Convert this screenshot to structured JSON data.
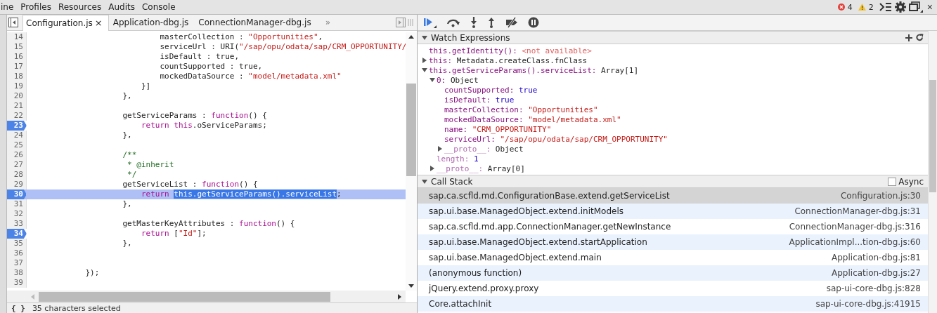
{
  "panel_tabs": [
    {
      "label": "ine",
      "selected": false
    },
    {
      "label": "Profiles",
      "selected": false
    },
    {
      "label": "Resources",
      "selected": false
    },
    {
      "label": "Audits",
      "selected": false
    },
    {
      "label": "Console",
      "selected": false
    }
  ],
  "counters": {
    "errors": "4",
    "warnings": "2"
  },
  "close": "×",
  "editor": {
    "tabs": [
      {
        "label": "Configuration.js",
        "selected": true,
        "close": "×"
      },
      {
        "label": "Application-dbg.js",
        "selected": false
      },
      {
        "label": "ConnectionManager-dbg.js",
        "selected": false
      }
    ],
    "more": "»",
    "lines": [
      {
        "number": "14",
        "breakpoint": false,
        "current": false,
        "tokens": [
          {
            "kind": "plain",
            "text": "                            masterCollection : "
          },
          {
            "kind": "string",
            "text": "\"Opportunities\""
          },
          {
            "kind": "plain",
            "text": ","
          }
        ]
      },
      {
        "number": "15",
        "breakpoint": false,
        "current": false,
        "tokens": [
          {
            "kind": "plain",
            "text": "                            serviceUrl : URI("
          },
          {
            "kind": "string",
            "text": "\"/sap/opu/odata/sap/CRM_OPPORTUNITY/"
          }
        ]
      },
      {
        "number": "16",
        "breakpoint": false,
        "current": false,
        "tokens": [
          {
            "kind": "plain",
            "text": "                            isDefault : true,"
          }
        ]
      },
      {
        "number": "17",
        "breakpoint": false,
        "current": false,
        "tokens": [
          {
            "kind": "plain",
            "text": "                            countSupported : true,"
          }
        ]
      },
      {
        "number": "18",
        "breakpoint": false,
        "current": false,
        "tokens": [
          {
            "kind": "plain",
            "text": "                            mockedDataSource : "
          },
          {
            "kind": "string",
            "text": "\"model/metadata.xml\""
          }
        ]
      },
      {
        "number": "19",
        "breakpoint": false,
        "current": false,
        "tokens": [
          {
            "kind": "plain",
            "text": "                        }]"
          }
        ]
      },
      {
        "number": "20",
        "breakpoint": false,
        "current": false,
        "tokens": [
          {
            "kind": "plain",
            "text": "                    },"
          }
        ]
      },
      {
        "number": "21",
        "breakpoint": false,
        "current": false
      },
      {
        "number": "22",
        "breakpoint": false,
        "current": false,
        "tokens": [
          {
            "kind": "plain",
            "text": "                    getServiceParams : "
          },
          {
            "kind": "keyword",
            "text": "function"
          },
          {
            "kind": "plain",
            "text": "() {"
          }
        ]
      },
      {
        "number": "23",
        "breakpoint": true,
        "current": false,
        "tokens": [
          {
            "kind": "keyword",
            "text": "                        return this"
          },
          {
            "kind": "plain",
            "text": ".oServiceParams;"
          }
        ]
      },
      {
        "number": "24",
        "breakpoint": false,
        "current": false,
        "tokens": [
          {
            "kind": "plain",
            "text": "                    },"
          }
        ]
      },
      {
        "number": "25",
        "breakpoint": false,
        "current": false
      },
      {
        "number": "26",
        "breakpoint": false,
        "current": false,
        "tokens": [
          {
            "kind": "comment",
            "text": "                    /**"
          }
        ]
      },
      {
        "number": "27",
        "breakpoint": false,
        "current": false,
        "tokens": [
          {
            "kind": "comment",
            "text": "                     * @inherit"
          }
        ]
      },
      {
        "number": "28",
        "breakpoint": false,
        "current": false,
        "tokens": [
          {
            "kind": "comment",
            "text": "                     */"
          }
        ]
      },
      {
        "number": "29",
        "breakpoint": false,
        "current": false,
        "tokens": [
          {
            "kind": "plain",
            "text": "                    getServiceList : "
          },
          {
            "kind": "keyword",
            "text": "function"
          },
          {
            "kind": "plain",
            "text": "() {"
          }
        ]
      },
      {
        "number": "30",
        "breakpoint": true,
        "current": true,
        "tokens": [
          {
            "kind": "keyword",
            "text": "                        return "
          },
          {
            "kind": "selection",
            "text": "this.getServiceParams().serviceList"
          },
          {
            "kind": "plain",
            "text": ";"
          }
        ]
      },
      {
        "number": "31",
        "breakpoint": false,
        "current": false,
        "tokens": [
          {
            "kind": "plain",
            "text": "                    },"
          }
        ]
      },
      {
        "number": "32",
        "breakpoint": false,
        "current": false
      },
      {
        "number": "33",
        "breakpoint": false,
        "current": false,
        "tokens": [
          {
            "kind": "plain",
            "text": "                    getMasterKeyAttributes : "
          },
          {
            "kind": "keyword",
            "text": "function"
          },
          {
            "kind": "plain",
            "text": "() {"
          }
        ]
      },
      {
        "number": "34",
        "breakpoint": true,
        "current": false,
        "tokens": [
          {
            "kind": "keyword",
            "text": "                        return"
          },
          {
            "kind": "plain",
            "text": " ["
          },
          {
            "kind": "string",
            "text": "\"Id\""
          },
          {
            "kind": "plain",
            "text": "];"
          }
        ]
      },
      {
        "number": "35",
        "breakpoint": false,
        "current": false,
        "tokens": [
          {
            "kind": "plain",
            "text": "                    },"
          }
        ]
      },
      {
        "number": "36",
        "breakpoint": false,
        "current": false
      },
      {
        "number": "37",
        "breakpoint": false,
        "current": false
      },
      {
        "number": "38",
        "breakpoint": false,
        "current": false,
        "tokens": [
          {
            "kind": "plain",
            "text": "            });"
          }
        ]
      },
      {
        "number": "39",
        "breakpoint": false,
        "current": false
      }
    ],
    "format_button": "{ }",
    "status_text": "35 characters selected"
  },
  "watch": {
    "title": "Watch Expressions",
    "expanded": true,
    "items": [
      {
        "name": "this.getIdentity():",
        "value": "<not available>",
        "kind": "error",
        "enumerable": true
      },
      {
        "name": "this:",
        "value": "Metadata.createClass.fnClass",
        "kind": "object",
        "expanded": false,
        "enumerable": true
      },
      {
        "name": "this.getServiceParams().serviceList:",
        "value": "Array[1]",
        "kind": "object",
        "expanded": true,
        "enumerable": true,
        "children": [
          {
            "name": "0:",
            "value": "Object",
            "kind": "object",
            "expanded": true,
            "enumerable": true,
            "children": [
              {
                "name": "countSupported:",
                "value": "true",
                "kind": "literal",
                "enumerable": true
              },
              {
                "name": "isDefault:",
                "value": "true",
                "kind": "literal",
                "enumerable": true
              },
              {
                "name": "masterCollection:",
                "value": "\"Opportunities\"",
                "kind": "string",
                "enumerable": true
              },
              {
                "name": "mockedDataSource:",
                "value": "\"model/metadata.xml\"",
                "kind": "string",
                "enumerable": true
              },
              {
                "name": "name:",
                "value": "\"CRM_OPPORTUNITY\"",
                "kind": "string",
                "enumerable": true
              },
              {
                "name": "serviceUrl:",
                "value": "\"/sap/opu/odata/sap/CRM_OPPORTUNITY\"",
                "kind": "string",
                "enumerable": true
              },
              {
                "name": "__proto__:",
                "value": "Object",
                "kind": "object",
                "expanded": false,
                "enumerable": false
              }
            ]
          },
          {
            "name": "length:",
            "value": "1",
            "kind": "literal",
            "enumerable": false
          },
          {
            "name": "__proto__:",
            "value": "Array[0]",
            "kind": "object",
            "expanded": false,
            "enumerable": false
          }
        ]
      }
    ]
  },
  "call_stack": {
    "title": "Call Stack",
    "expanded": true,
    "async": {
      "label": "Async",
      "checked": false
    },
    "frames": [
      {
        "function": "sap.ca.scfld.md.ConfigurationBase.extend.getServiceList",
        "location": "Configuration.js:30",
        "selected": true
      },
      {
        "function": "sap.ui.base.ManagedObject.extend.initModels",
        "location": "ConnectionManager-dbg.js:31",
        "selected": false
      },
      {
        "function": "sap.ca.scfld.md.app.ConnectionManager.getNewInstance",
        "location": "ConnectionManager-dbg.js:316",
        "selected": false
      },
      {
        "function": "sap.ui.base.ManagedObject.extend.startApplication",
        "location": "ApplicationImpl...tion-dbg.js:60",
        "selected": false
      },
      {
        "function": "sap.ui.base.ManagedObject.extend.main",
        "location": "Application-dbg.js:81",
        "selected": false
      },
      {
        "function": "(anonymous function)",
        "location": "Application-dbg.js:27",
        "selected": false
      },
      {
        "function": "jQuery.extend.proxy.proxy",
        "location": "sap-ui-core-dbg.js:828",
        "selected": false
      },
      {
        "function": "Core.attachInit",
        "location": "sap-ui-core-dbg.js:41915",
        "selected": false
      }
    ]
  }
}
